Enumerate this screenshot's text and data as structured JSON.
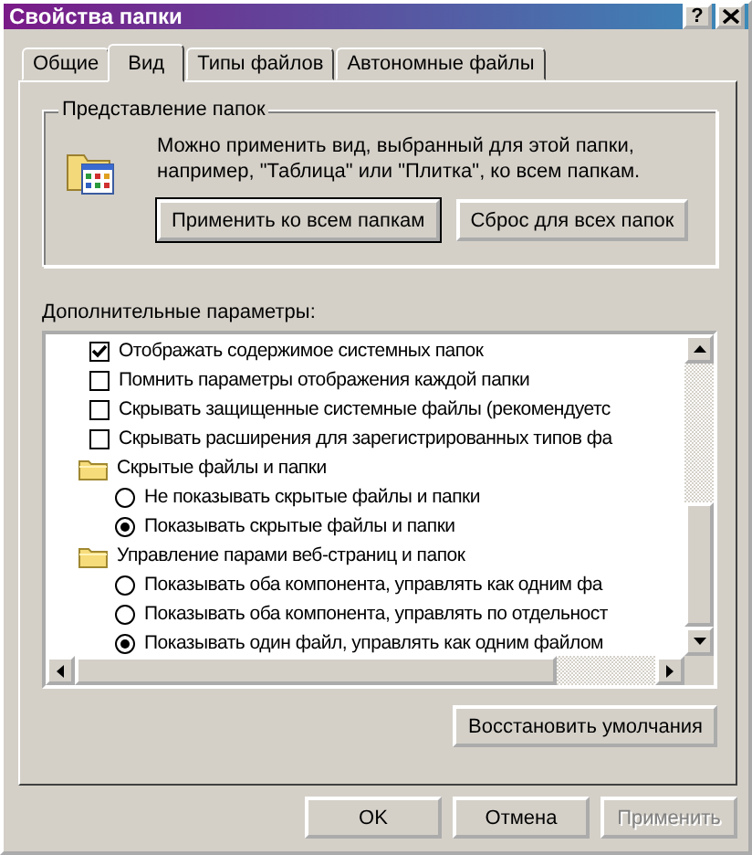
{
  "window": {
    "title": "Свойства папки",
    "help": "?"
  },
  "tabs": [
    {
      "label": "Общие",
      "selected": false
    },
    {
      "label": "Вид",
      "selected": true
    },
    {
      "label": "Типы файлов",
      "selected": false
    },
    {
      "label": "Автономные файлы",
      "selected": false
    }
  ],
  "folder_views": {
    "title": "Представление папок",
    "description": "Можно применить вид, выбранный для этой папки, например, \"Таблица\" или \"Плитка\", ко всем папкам.",
    "buttons": [
      "Применить ко всем папкам",
      "Сброс для всех папок"
    ]
  },
  "advanced": {
    "label": "Дополнительные параметры:",
    "items": [
      {
        "kind": "checkbox",
        "label": "Отображать содержимое системных папок",
        "checked": true
      },
      {
        "kind": "checkbox",
        "label": "Помнить параметры отображения каждой папки",
        "checked": false
      },
      {
        "kind": "checkbox",
        "label": "Скрывать защищенные системные файлы (рекомендуетс",
        "checked": false
      },
      {
        "kind": "checkbox",
        "label": "Скрывать расширения для зарегистрированных типов фа",
        "checked": false
      },
      {
        "kind": "folder",
        "label": "Скрытые файлы и папки",
        "children": [
          {
            "kind": "radio",
            "label": "Не показывать скрытые файлы и папки",
            "selected": false
          },
          {
            "kind": "radio",
            "label": "Показывать скрытые файлы и папки",
            "selected": true
          }
        ]
      },
      {
        "kind": "folder",
        "label": "Управление парами веб-страниц и папок",
        "children": [
          {
            "kind": "radio",
            "label": "Показывать оба компонента, управлять как одним фа",
            "selected": false
          },
          {
            "kind": "radio",
            "label": "Показывать оба компонента, управлять по отдельност",
            "selected": false
          },
          {
            "kind": "radio",
            "label": "Показывать один файл, управлять как одним файлом",
            "selected": true
          }
        ]
      }
    ]
  },
  "restore_button": "Восстановить умолчания",
  "buttons": [
    {
      "label": "OK",
      "disabled": false
    },
    {
      "label": "Отмена",
      "disabled": false
    },
    {
      "label": "Применить",
      "disabled": true
    }
  ]
}
